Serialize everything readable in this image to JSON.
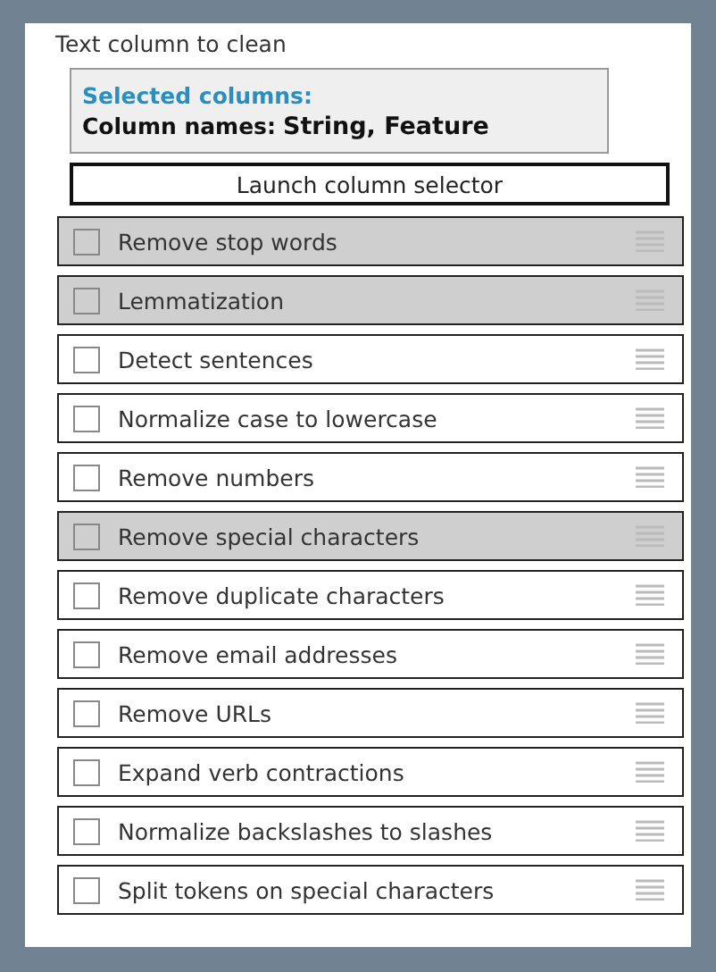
{
  "section_label": "Text column to clean",
  "selection": {
    "heading": "Selected columns:",
    "names_label": "Column names:",
    "names_value": "String, Feature"
  },
  "launch_button": "Launch column selector",
  "options": [
    {
      "label": "Remove stop words",
      "checked": false,
      "selected": true
    },
    {
      "label": "Lemmatization",
      "checked": false,
      "selected": true
    },
    {
      "label": "Detect sentences",
      "checked": false,
      "selected": false
    },
    {
      "label": "Normalize case to lowercase",
      "checked": false,
      "selected": false
    },
    {
      "label": "Remove numbers",
      "checked": false,
      "selected": false
    },
    {
      "label": "Remove special characters",
      "checked": false,
      "selected": true
    },
    {
      "label": "Remove duplicate characters",
      "checked": false,
      "selected": false
    },
    {
      "label": "Remove email addresses",
      "checked": false,
      "selected": false
    },
    {
      "label": "Remove URLs",
      "checked": false,
      "selected": false
    },
    {
      "label": "Expand verb contractions",
      "checked": false,
      "selected": false
    },
    {
      "label": "Normalize backslashes to slashes",
      "checked": false,
      "selected": false
    },
    {
      "label": "Split tokens on special characters",
      "checked": false,
      "selected": false
    }
  ]
}
